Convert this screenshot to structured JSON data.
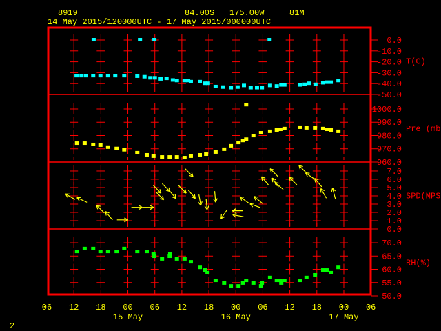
{
  "header": {
    "station": "8919",
    "lat": "84.00S",
    "lon": "175.00W",
    "elev": "81M",
    "range": "14 May 2015/120000UTC - 17 May 2015/000000UTC"
  },
  "page_number": "2",
  "colors": {
    "frame": "#ff0000",
    "text": "#ffff00",
    "temp": "#00ffff",
    "pressure": "#ffff00",
    "wind": "#ffff00",
    "rh": "#00ff00"
  },
  "chart_data": {
    "type": "scatter",
    "title": "8919 84.00S 175.00W 81M",
    "x_axis": {
      "unit": "hours since 14 May 2015 06UTC",
      "xlim": [
        0,
        72
      ],
      "tick_hours": [
        0,
        6,
        12,
        18,
        24,
        30,
        36,
        42,
        48,
        54,
        60,
        66,
        72
      ],
      "tick_labels": [
        "06",
        "12",
        "18",
        "00",
        "06",
        "12",
        "18",
        "00",
        "06",
        "12",
        "18",
        "00",
        "06"
      ],
      "date_labels": [
        {
          "hour": 18,
          "label": "15 May"
        },
        {
          "hour": 42,
          "label": "16 May"
        },
        {
          "hour": 66,
          "label": "17 May"
        }
      ]
    },
    "panels": [
      {
        "name": "temperature",
        "ylabel": "T(C)",
        "ylim": [
          -50,
          11.4
        ],
        "ticks": [
          0,
          -10,
          -20,
          -30,
          -40,
          -50
        ],
        "tick_labels": [
          "0.0",
          "-10.0",
          "-20.0",
          "-30.0",
          "-40.0",
          "-50.0"
        ],
        "points": [
          [
            6.6,
            -33
          ],
          [
            7.7,
            -33
          ],
          [
            8.7,
            -33
          ],
          [
            10.3,
            -33
          ],
          [
            11.9,
            -33
          ],
          [
            13.6,
            -33
          ],
          [
            15.2,
            -33
          ],
          [
            17.2,
            -33
          ],
          [
            20.1,
            -33.5
          ],
          [
            21.7,
            -34
          ],
          [
            23.0,
            -35
          ],
          [
            24.0,
            -35
          ],
          [
            25.3,
            -36
          ],
          [
            26.6,
            -35.5
          ],
          [
            28.0,
            -37
          ],
          [
            28.9,
            -37.5
          ],
          [
            30.6,
            -37.5
          ],
          [
            31.4,
            -37.5
          ],
          [
            32.0,
            -38.5
          ],
          [
            34.0,
            -38.5
          ],
          [
            35.2,
            -40
          ],
          [
            35.8,
            -40
          ],
          [
            37.5,
            -43
          ],
          [
            39.2,
            -43.5
          ],
          [
            40.9,
            -44
          ],
          [
            42.4,
            -43.5
          ],
          [
            43.8,
            -42
          ],
          [
            45.3,
            -44
          ],
          [
            46.7,
            -44
          ],
          [
            47.8,
            -44
          ],
          [
            49.6,
            -42
          ],
          [
            51.1,
            -42.5
          ],
          [
            52.1,
            -41.5
          ],
          [
            52.8,
            -41.5
          ],
          [
            56.2,
            -41.5
          ],
          [
            57.3,
            -41
          ],
          [
            58.2,
            -40
          ],
          [
            59.7,
            -41
          ],
          [
            61.4,
            -39.5
          ],
          [
            62.2,
            -39
          ],
          [
            63.1,
            -39
          ],
          [
            64.8,
            -37.5
          ],
          [
            10.4,
            0
          ],
          [
            20.7,
            0
          ],
          [
            23.9,
            0
          ],
          [
            49.5,
            0
          ]
        ]
      },
      {
        "name": "pressure",
        "ylabel": "Pre (mb)",
        "ylim": [
          960,
          1010.9
        ],
        "ticks": [
          1000,
          990,
          980,
          970,
          960
        ],
        "tick_labels": [
          "1000.0",
          "990.0",
          "980.0",
          "970.0",
          "960.0"
        ],
        "points": [
          [
            6.7,
            974
          ],
          [
            8.4,
            974
          ],
          [
            10.3,
            973
          ],
          [
            11.9,
            972.5
          ],
          [
            13.6,
            971
          ],
          [
            15.5,
            970
          ],
          [
            17.2,
            969
          ],
          [
            20.1,
            966.8
          ],
          [
            22.2,
            965.2
          ],
          [
            23.7,
            964.2
          ],
          [
            25.6,
            963.6
          ],
          [
            27.3,
            963.6
          ],
          [
            28.9,
            963.6
          ],
          [
            30.6,
            963.1
          ],
          [
            32.0,
            964.2
          ],
          [
            34.0,
            965.2
          ],
          [
            35.4,
            965.7
          ],
          [
            37.5,
            967.3
          ],
          [
            39.4,
            969.4
          ],
          [
            40.9,
            972
          ],
          [
            42.6,
            974.5
          ],
          [
            43.6,
            976
          ],
          [
            44.3,
            977
          ],
          [
            45.9,
            979.7
          ],
          [
            47.6,
            981.8
          ],
          [
            49.6,
            982.9
          ],
          [
            51.1,
            983.9
          ],
          [
            51.9,
            984.4
          ],
          [
            52.8,
            985
          ],
          [
            56.2,
            986
          ],
          [
            57.7,
            985.5
          ],
          [
            59.6,
            985.5
          ],
          [
            61.4,
            985
          ],
          [
            62.2,
            984.4
          ],
          [
            63.1,
            983.9
          ],
          [
            64.8,
            982.9
          ],
          [
            44.3,
            1003
          ]
        ]
      },
      {
        "name": "wind",
        "ylabel": "SPD(MPS)",
        "ylim": [
          0,
          8.08
        ],
        "ticks": [
          7,
          6,
          5,
          4,
          3,
          2,
          1,
          0
        ],
        "tick_labels": [
          "7.0",
          "6.0",
          "5.0",
          "4.0",
          "3.0",
          "2.0",
          "1.0",
          "0.0"
        ],
        "arrows_hour_speed_toward_deg": [
          [
            5.2,
            3.9,
            300
          ],
          [
            7.8,
            3.5,
            295
          ],
          [
            11.9,
            2.4,
            315
          ],
          [
            13.8,
            1.6,
            320
          ],
          [
            16.8,
            1.1,
            90
          ],
          [
            20.0,
            2.6,
            90
          ],
          [
            22.5,
            2.6,
            90
          ],
          [
            24.5,
            4.8,
            135
          ],
          [
            25.1,
            4.0,
            135
          ],
          [
            26.5,
            5.0,
            135
          ],
          [
            27.9,
            4.2,
            140
          ],
          [
            30.1,
            4.8,
            135
          ],
          [
            32.2,
            4.2,
            140
          ],
          [
            31.6,
            6.8,
            135
          ],
          [
            34.0,
            3.5,
            170
          ],
          [
            35.5,
            3.0,
            175
          ],
          [
            37.4,
            3.9,
            175
          ],
          [
            39.4,
            1.8,
            215
          ],
          [
            42.4,
            2.2,
            270
          ],
          [
            42.5,
            1.6,
            280
          ],
          [
            43.9,
            3.5,
            305
          ],
          [
            46.3,
            2.8,
            290
          ],
          [
            47.0,
            3.5,
            310
          ],
          [
            48.5,
            5.8,
            320
          ],
          [
            50.5,
            6.8,
            315
          ],
          [
            50.8,
            5.6,
            325
          ],
          [
            51.6,
            5.2,
            310
          ],
          [
            54.7,
            5.8,
            315
          ],
          [
            56.9,
            7.2,
            315
          ],
          [
            58.5,
            6.4,
            305
          ],
          [
            60.3,
            5.6,
            320
          ],
          [
            61.5,
            4.3,
            330
          ],
          [
            63.8,
            4.3,
            345
          ]
        ]
      },
      {
        "name": "rh",
        "ylabel": "RH(%)",
        "ylim": [
          50,
          75.2
        ],
        "ticks": [
          70,
          65,
          60,
          55,
          50
        ],
        "tick_labels": [
          "70.0",
          "65.0",
          "60.0",
          "55.0",
          "50.0"
        ],
        "points": [
          [
            6.7,
            66.6
          ],
          [
            8.4,
            67.7
          ],
          [
            10.3,
            67.7
          ],
          [
            11.9,
            66.6
          ],
          [
            13.6,
            66.6
          ],
          [
            15.5,
            66.6
          ],
          [
            17.2,
            67.7
          ],
          [
            20.1,
            66.6
          ],
          [
            22.2,
            66.6
          ],
          [
            23.7,
            65.8
          ],
          [
            23.9,
            64.8
          ],
          [
            25.6,
            63.8
          ],
          [
            27.3,
            64.8
          ],
          [
            27.4,
            65.8
          ],
          [
            28.9,
            63.8
          ],
          [
            30.6,
            63.8
          ],
          [
            32.0,
            62.7
          ],
          [
            34.0,
            60.6
          ],
          [
            35.1,
            59.6
          ],
          [
            35.7,
            58.6
          ],
          [
            37.5,
            55.7
          ],
          [
            39.4,
            54.7
          ],
          [
            40.9,
            53.6
          ],
          [
            42.6,
            53.6
          ],
          [
            43.6,
            54.7
          ],
          [
            44.3,
            55.7
          ],
          [
            45.9,
            54.7
          ],
          [
            47.6,
            53.6
          ],
          [
            47.8,
            54.7
          ],
          [
            49.6,
            56.8
          ],
          [
            51.1,
            55.7
          ],
          [
            51.9,
            55.7
          ],
          [
            52.1,
            54.7
          ],
          [
            52.8,
            55.7
          ],
          [
            56.2,
            55.7
          ],
          [
            57.7,
            56.8
          ],
          [
            59.6,
            57.8
          ],
          [
            61.4,
            59.6
          ],
          [
            62.2,
            59.6
          ],
          [
            63.1,
            58.6
          ],
          [
            64.8,
            60.6
          ]
        ]
      }
    ]
  }
}
